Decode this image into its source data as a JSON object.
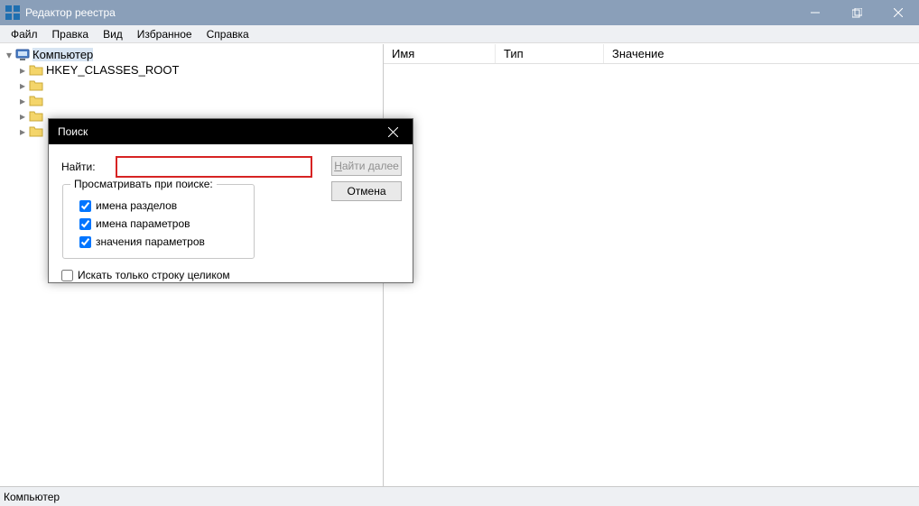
{
  "titlebar": {
    "title": "Редактор реестра"
  },
  "menu": {
    "file": "Файл",
    "edit": "Правка",
    "view": "Вид",
    "favorites": "Избранное",
    "help": "Справка"
  },
  "tree": {
    "root": "Компьютер",
    "items": [
      "HKEY_CLASSES_ROOT",
      "",
      "",
      "",
      ""
    ]
  },
  "columns": {
    "name": "Имя",
    "type": "Тип",
    "value": "Значение"
  },
  "statusbar": {
    "path": "Компьютер"
  },
  "dialog": {
    "title": "Поиск",
    "find_label": "Найти:",
    "find_value": "",
    "find_next": "Найти далее",
    "cancel": "Отмена",
    "group_label": "Просматривать при поиске:",
    "chk_keys": "имена разделов",
    "chk_values": "имена параметров",
    "chk_data": "значения параметров",
    "chk_whole": "Искать только строку целиком",
    "chk_keys_v": true,
    "chk_values_v": true,
    "chk_data_v": true,
    "chk_whole_v": false
  }
}
